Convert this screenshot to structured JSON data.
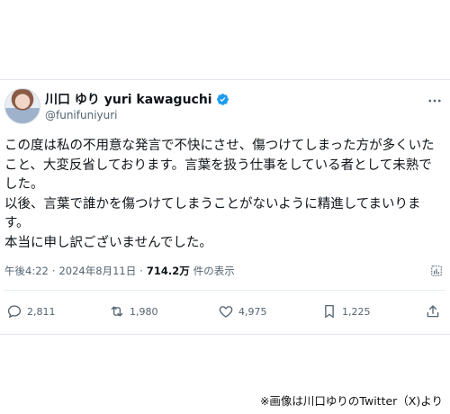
{
  "tweet": {
    "display_name": "川口 ゆり yuri kawaguchi",
    "handle": "@funifuniyuri",
    "text_lines": [
      "この度は私の不用意な発言で不快にさせ、傷つけてしまった方が多くいた",
      "こと、大変反省しております。言葉を扱う仕事をしている者として未熟で",
      "した。",
      "以後、言葉で誰かを傷つけてしまうことがないように精進してまいりま",
      "す。",
      "本当に申し訳ございませんでした。"
    ],
    "time": "午後4:22",
    "separator": "·",
    "date": "2024年8月11日",
    "views_count": "714.2万",
    "views_label": "件の表示"
  },
  "actions": {
    "replies": "2,811",
    "retweets": "1,980",
    "likes": "4,975",
    "bookmarks": "1,225"
  },
  "icons": {
    "verified": "verified-badge-icon",
    "more": "more-icon",
    "analytics": "analytics-icon",
    "reply": "reply-icon",
    "retweet": "retweet-icon",
    "like": "heart-icon",
    "bookmark": "bookmark-icon",
    "share": "share-icon"
  },
  "colors": {
    "verified": "#1d9bf0",
    "text": "#0f1419",
    "secondary": "#536471"
  },
  "caption": "※画像は川口ゆりのTwitter（X)より"
}
